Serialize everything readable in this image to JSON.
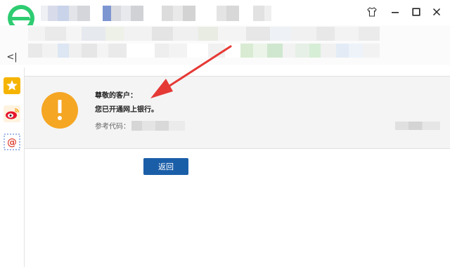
{
  "window": {
    "controls": {
      "skin": "skin-icon",
      "minimize": "minimize-icon",
      "maximize": "maximize-icon",
      "close": "close-icon"
    }
  },
  "sidebar": {
    "items": [
      {
        "name": "favorites-star-icon",
        "color": "#f5b400"
      },
      {
        "name": "weibo-icon",
        "color": "#e6162d"
      },
      {
        "name": "email-at-icon",
        "color": "#e04a3a"
      }
    ],
    "collapse_glyph": "<|"
  },
  "notice": {
    "icon": "exclamation-icon",
    "icon_color": "#f5a623",
    "greeting": "尊敬的客户：",
    "message": "您已开通网上银行。",
    "ref_label": "参考代码："
  },
  "actions": {
    "return_label": "返回",
    "return_color": "#1b5ea8"
  },
  "annotation": {
    "arrow_color": "#e53935"
  }
}
